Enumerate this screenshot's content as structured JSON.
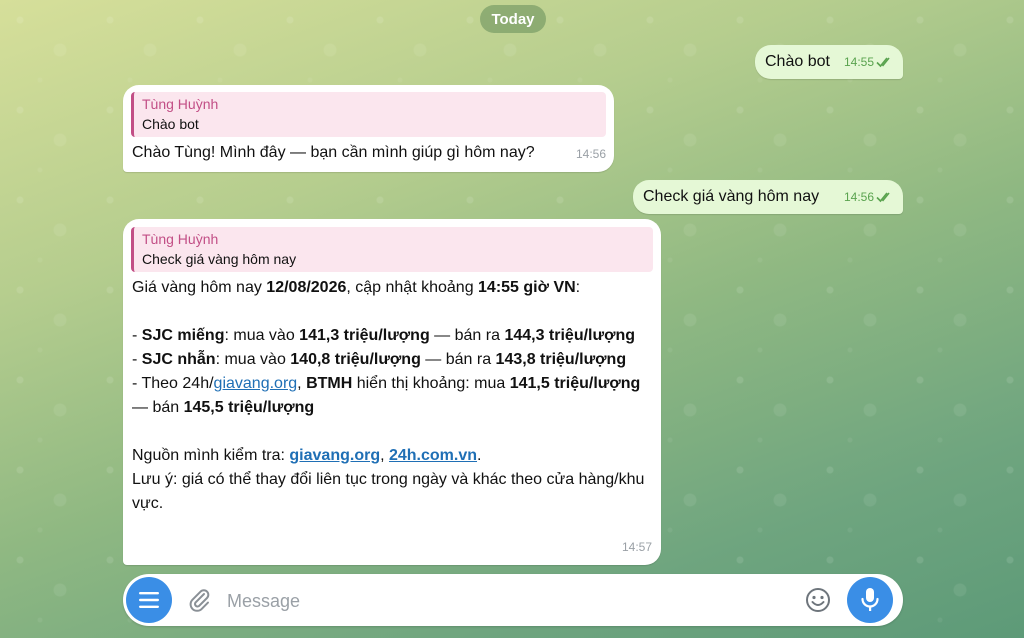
{
  "chat": {
    "date_label": "Today",
    "messages": [
      {
        "text": "Chào bot",
        "time": "14:55"
      },
      {
        "reply_author": "Tùng Huỳnh",
        "reply_text": "Chào bot",
        "text": "Chào Tùng! Mình đây — bạn cần mình giúp gì hôm nay?",
        "time": "14:56"
      },
      {
        "text": "Check giá vàng hôm nay",
        "time": "14:56"
      },
      {
        "reply_author": "Tùng Huỳnh",
        "reply_text": "Check giá vàng hôm nay",
        "intro": {
          "a": "Giá vàng hôm nay ",
          "date": "12/08/2026",
          "b": ", cập nhật khoảng ",
          "time": "14:55 giờ VN",
          "c": ":"
        },
        "sjc_bar": {
          "a": "- ",
          "name": "SJC miếng",
          "b": ": mua vào ",
          "buy": "141,3 triệu/lượng",
          "c": " — bán ra ",
          "sell": "144,3 triệu/lượng"
        },
        "sjc_ring": {
          "a": "- ",
          "name": "SJC nhẫn",
          "b": ": mua vào ",
          "buy": "140,8 triệu/lượng",
          "c": " — bán ra ",
          "sell": "143,8 triệu/lượng"
        },
        "btmh": {
          "a": "- Theo 24h/",
          "link": "giavang.org",
          "b": ", ",
          "name": "BTMH",
          "c": " hiển thị khoảng: mua ",
          "buy": "141,5 triệu/lượng",
          "d": " — bán ",
          "sell": "145,5 triệu/lượng"
        },
        "sources": {
          "a": "Nguồn mình kiểm tra: ",
          "link1": "giavang.org",
          "b": ", ",
          "link2": "24h.com.vn",
          "c": "."
        },
        "note": "Lưu ý: giá có thể thay đổi liên tục trong ngày và khác theo cửa hàng/khu vực.",
        "time": "14:57"
      }
    ]
  },
  "composer": {
    "placeholder": "Message",
    "menu_icon": "hamburger-menu-icon",
    "attach_icon": "paperclip-icon",
    "emoji_icon": "smiley-icon",
    "mic_icon": "microphone-icon"
  },
  "colors": {
    "accent": "#3a8ee6",
    "outgoing_bubble": "#e5f8d6",
    "reply_author": "#c24f86",
    "link": "#1f6fb5",
    "read_check": "#5aa34f"
  }
}
